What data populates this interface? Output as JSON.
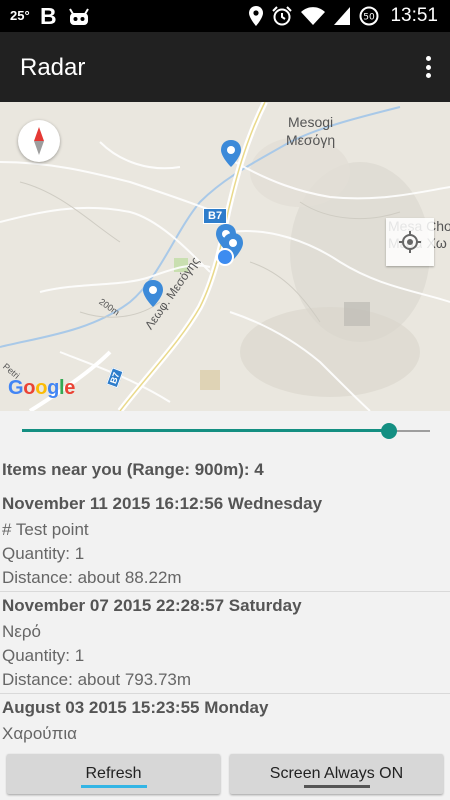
{
  "status_bar": {
    "temperature": "25°",
    "notification_icons": [
      "b-app-icon",
      "android-bot-icon"
    ],
    "system_icons": [
      "location-pin-icon",
      "alarm-clock-icon",
      "wifi-icon",
      "signal-icon",
      "battery-icon"
    ],
    "battery_level": "50",
    "time": "13:51"
  },
  "app_bar": {
    "title": "Radar",
    "overflow_icon": "more-vert-icon"
  },
  "map": {
    "labels": {
      "mesogi_latin": "Mesogi",
      "mesogi_greek": "Μεσόγη",
      "mesa_latin": "Mesa Cho",
      "mesa_greek": "Μέσα Χω",
      "road_greek": "Λεωφ. Μεσόγης",
      "road_b7_top": "B7",
      "road_b7_bottom": "B7",
      "elevation_200m": "200m",
      "petri": "Petri"
    },
    "google_logo": "Google",
    "compass_icon": "compass-icon",
    "my_location_icon": "my-location-icon",
    "colors": {
      "marker": "#3c8ad9",
      "my_location": "#3d8cf0",
      "road": "#ffffff",
      "river": "#a9c9e8"
    }
  },
  "range_slider": {
    "value_fraction": 0.9,
    "color": "#148f82"
  },
  "results": {
    "summary": "Items near you (Range: 900m): 4",
    "items": [
      {
        "date": "November 11 2015 16:12:56 Wednesday",
        "name": "# Test point",
        "quantity": "Quantity: 1",
        "distance": "Distance: about 88.22m"
      },
      {
        "date": "November 07 2015 22:28:57 Saturday",
        "name": "Νερό",
        "quantity": "Quantity: 1",
        "distance": "Distance: about 793.73m"
      },
      {
        "date": "August 03 2015 15:23:55 Monday",
        "name": "Χαρούπια"
      }
    ]
  },
  "buttons": {
    "refresh": "Refresh",
    "screen_always_on": "Screen Always ON",
    "refresh_underline_color": "#33b5e5",
    "screen_underline_color": "#555555"
  }
}
